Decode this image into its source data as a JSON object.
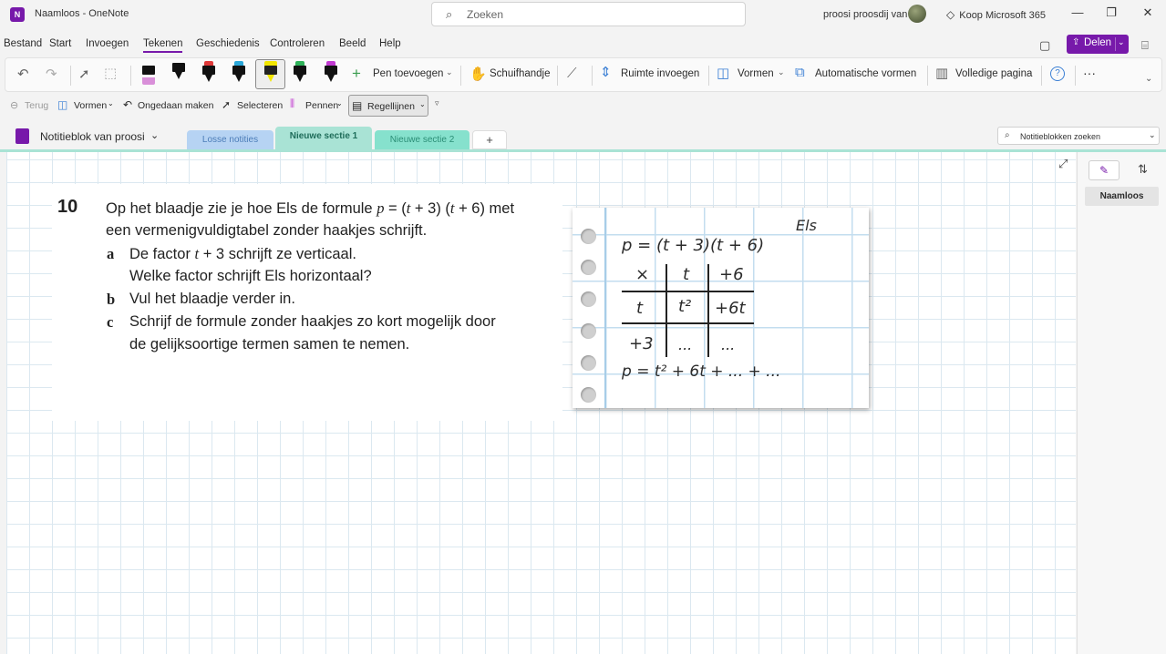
{
  "window": {
    "app_icon_letter": "N",
    "title": "Naamloos  -  OneNote",
    "search_placeholder": "Zoeken",
    "user": "proosi proosdij van",
    "buy": "Koop Microsoft 365",
    "controls": {
      "minimize": "—",
      "maximize": "❐",
      "close": "✕"
    }
  },
  "menu": {
    "items": [
      "Bestand",
      "Start",
      "Invoegen",
      "Tekenen",
      "Geschiedenis",
      "Controleren",
      "Beeld",
      "Help"
    ],
    "active_index": 3,
    "share_label": "Delen"
  },
  "ribbon": {
    "undo": "↶",
    "redo": "↷",
    "lasso": "⬚",
    "add_pen": "Pen toevoegen",
    "pan": "Schuifhandje",
    "insert_space": "Ruimte invoegen",
    "shapes": "Vormen",
    "auto_shapes": "Automatische vormen",
    "full_page": "Volledige pagina",
    "help": "?",
    "more": "···",
    "pen_caps": [
      "#d98fd9",
      "#111111",
      "#e03a3a",
      "#2aa7d9",
      "#f2e600",
      "#2fb35a",
      "#c13ad1"
    ]
  },
  "toolbar2": {
    "back": "Terug",
    "shapes": "Vormen",
    "undo": "Ongedaan maken",
    "select": "Selecteren",
    "pens": "Pennen",
    "rule_lines": "Regellijnen"
  },
  "notebook": {
    "name": "Notitieblok van proosi",
    "tabs": [
      "Losse notities",
      "Nieuwe sectie 1",
      "Nieuwe sectie 2",
      "+"
    ],
    "active_tab": 1,
    "search_placeholder": "Notitieblokken zoeken"
  },
  "question": {
    "number": "10",
    "intro_1_pre": "Op het blaadje zie je hoe Els de formule ",
    "intro_1_formula": "p",
    "intro_1_eq": " = (",
    "intro_1_t1": "t",
    "intro_1_mid": " + 3) (",
    "intro_1_t2": "t",
    "intro_1_post": " + 6) met",
    "intro_2": "een vermenigvuldigtabel zonder haakjes schrijft.",
    "a_label": "a",
    "a_line1_pre": "De factor ",
    "a_line1_var": "t",
    "a_line1_post": " + 3 schrijft ze verticaal.",
    "a_line2": "Welke factor schrijft Els horizontaal?",
    "b_label": "b",
    "b_line": "Vul het blaadje verder in.",
    "c_label": "c",
    "c_line1": "Schrijf de formule zonder haakjes zo kort mogelijk door",
    "c_line2": "de gelijksoortige termen samen te nemen."
  },
  "sheet": {
    "name": "Els",
    "formula": "p = (t + 3)(t + 6)",
    "header": [
      "×",
      "t",
      "+6"
    ],
    "row1": [
      "t",
      "t²",
      "+6t"
    ],
    "row2": [
      "+3",
      "...",
      "..."
    ],
    "result": "p = t² + 6t + ... + ..."
  },
  "pages": {
    "title": "Naamloos"
  }
}
